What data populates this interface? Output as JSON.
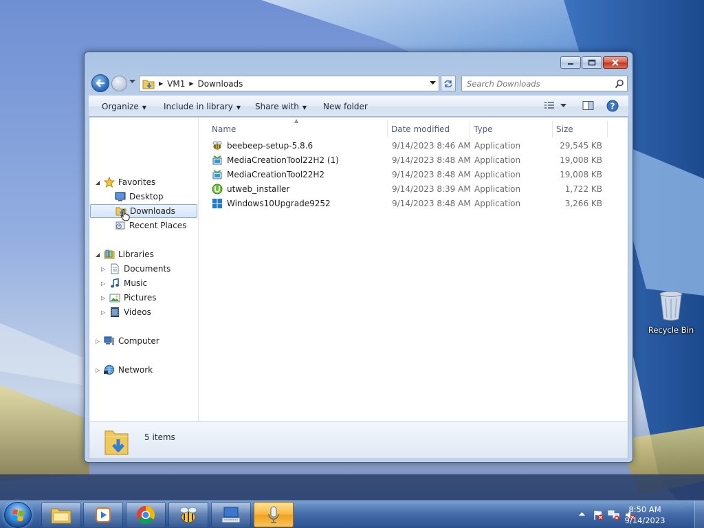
{
  "desktop": {
    "recycle_bin_label": "Recycle Bin"
  },
  "window": {
    "address": {
      "crumbs": [
        "VM1",
        "Downloads"
      ]
    },
    "search_placeholder": "Search Downloads",
    "commands": {
      "organize": "Organize",
      "include_in_library": "Include in library",
      "share_with": "Share with",
      "new_folder": "New folder"
    },
    "nav": {
      "favorites": "Favorites",
      "desktop": "Desktop",
      "downloads": "Downloads",
      "recent_places": "Recent Places",
      "libraries": "Libraries",
      "documents": "Documents",
      "music": "Music",
      "pictures": "Pictures",
      "videos": "Videos",
      "computer": "Computer",
      "network": "Network"
    },
    "columns": {
      "name": "Name",
      "date_modified": "Date modified",
      "type": "Type",
      "size": "Size"
    },
    "files": [
      {
        "name": "beebeep-setup-5.8.6",
        "date": "9/14/2023 8:46 AM",
        "type": "Application",
        "size": "29,545 KB",
        "icon": "beebeep-icon"
      },
      {
        "name": "MediaCreationTool22H2 (1)",
        "date": "9/14/2023 8:48 AM",
        "type": "Application",
        "size": "19,008 KB",
        "icon": "media-creation-tool-icon"
      },
      {
        "name": "MediaCreationTool22H2",
        "date": "9/14/2023 8:48 AM",
        "type": "Application",
        "size": "19,008 KB",
        "icon": "media-creation-tool-icon"
      },
      {
        "name": "utweb_installer",
        "date": "9/14/2023 8:39 AM",
        "type": "Application",
        "size": "1,722 KB",
        "icon": "utorrent-icon"
      },
      {
        "name": "Windows10Upgrade9252",
        "date": "9/14/2023 8:48 AM",
        "type": "Application",
        "size": "3,266 KB",
        "icon": "windows-logo-icon"
      }
    ],
    "details": {
      "item_count": "5 items"
    }
  },
  "taskbar": {
    "clock_time": "8:50 AM",
    "clock_date": "9/14/2023"
  },
  "colors": {
    "selection_bg": "#d4e6fb",
    "selection_border": "#84acdd",
    "taskbar_amber": "#f0a01e"
  }
}
